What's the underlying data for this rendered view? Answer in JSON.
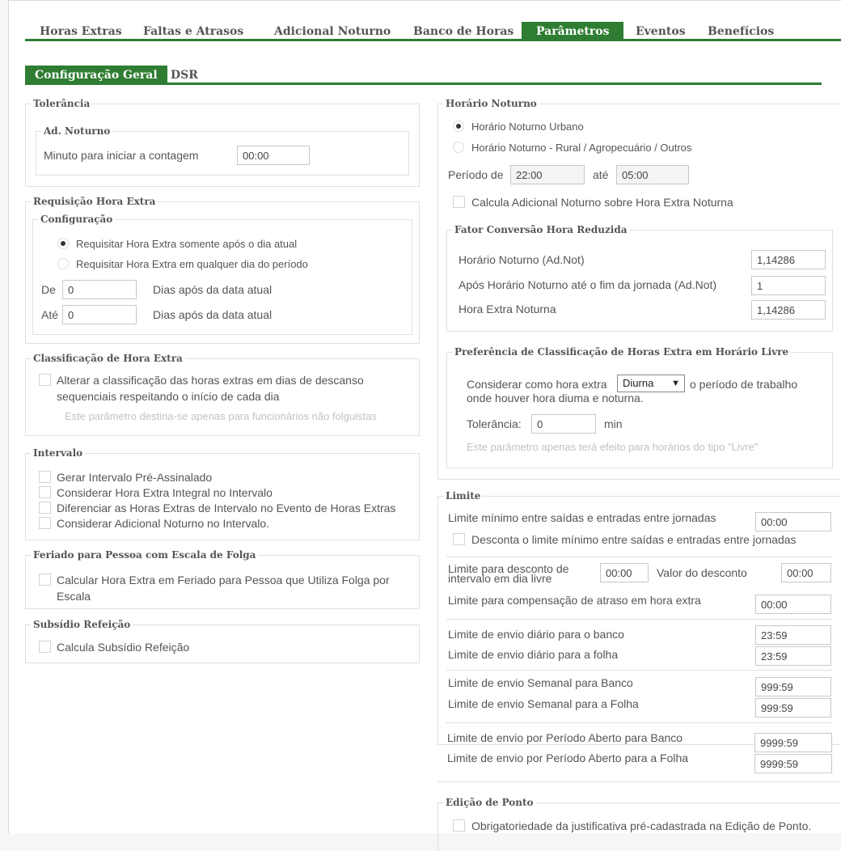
{
  "tabs": [
    "Horas Extras",
    "Faltas e Atrasos",
    "Adicional Noturno",
    "Banco de Horas",
    "Parâmetros",
    "Eventos",
    "Benefícios"
  ],
  "subtabs": [
    "Configuração Geral",
    "DSR"
  ],
  "tolerancia": {
    "title": "Tolerância",
    "ad_noturno": "Ad. Noturno",
    "minuto_label": "Minuto para iniciar a contagem",
    "minuto_value": "00:00"
  },
  "requisicao": {
    "title": "Requisição Hora Extra",
    "config": "Configuração",
    "opt1": "Requisitar Hora Extra somente após o dia atual",
    "opt2": "Requisitar Hora Extra em qualquer dia do período",
    "de_label": "De",
    "de_value": "0",
    "ate_label": "Até",
    "ate_value": "0",
    "dias_apos": "Dias após da data atual"
  },
  "classificacao": {
    "title": "Classificação de Hora Extra",
    "line1": "Alterar a classificação das horas extras em dias de descanso",
    "line2": "sequenciais respeitando o início de cada dia",
    "hint": "Este parâmetro destina-se apenas para funcionários não folguistas"
  },
  "intervalo": {
    "title": "Intervalo",
    "items": [
      "Gerar Intervalo Pré-Assinalado",
      "Considerar Hora Extra Integral no Intervalo",
      "Diferenciar as Horas Extras de Intervalo no Evento de Horas Extras",
      "Considerar Adicional Noturno no Intervalo."
    ]
  },
  "feriado": {
    "title": "Feriado para Pessoa com Escala de Folga",
    "line1": "Calcular Hora Extra em Feriado para Pessoa que Utiliza Folga por",
    "line2": "Escala"
  },
  "subsidio": {
    "title": "Subsídio Refeição",
    "item": "Calcula Subsídio Refeição"
  },
  "horario_noturno": {
    "title": "Horário Noturno",
    "opt1": "Horário Noturno Urbano",
    "opt2": "Horário Noturno - Rural / Agropecuário / Outros",
    "periodo_de": "Período de",
    "de_value": "22:00",
    "ate": "até",
    "ate_value": "05:00",
    "calcula": "Calcula Adicional Noturno sobre Hora Extra Noturna",
    "fator_title": "Fator Conversão Hora Reduzida",
    "fator_rows": [
      {
        "label": "Horário Noturno (Ad.Not)",
        "value": "1,14286"
      },
      {
        "label": "Após Horário Noturno até o fim da jornada (Ad.Not)",
        "value": "1"
      },
      {
        "label": "Hora Extra Noturna",
        "value": "1,14286"
      }
    ],
    "pref_title": "Preferência de Classificação de Horas Extra em Horário Livre",
    "pref_line1_a": "Considerar como hora extra",
    "pref_select": "Diurna",
    "pref_line1_b": "o período de trabalho",
    "pref_line2": "onde houver hora diuma e noturna.",
    "tolerancia_label": "Tolerância:",
    "tolerancia_value": "0",
    "min": "min",
    "hint": "Este parâmetro apenas terá efeito para horários do tipo \"Livre\""
  },
  "limite": {
    "title": "Limite",
    "min_label": "Limite mínimo entre saídas e entradas entre jornadas",
    "min_value": "00:00",
    "desconta": "Desconta o limite mínimo entre saídas e entradas entre jornadas",
    "desc_label_1": "Limite para desconto de",
    "desc_label_2": "intervalo em dia livre",
    "desc_value": "00:00",
    "valor_label": "Valor do desconto",
    "valor_value": "00:00",
    "comp_label": "Limite para compensação de atraso em hora extra",
    "comp_value": "00:00",
    "diario_banco_label": "Limite de envio diário para o banco",
    "diario_banco_value": "23:59",
    "diario_folha_label": "Limite de envio diário para a folha",
    "diario_folha_value": "23:59",
    "sem_banco_label": "Limite de envio Semanal para Banco",
    "sem_banco_value": "999:59",
    "sem_folha_label": "Limite de envio Semanal para a Folha",
    "sem_folha_value": "999:59",
    "per_banco_label": "Limite de envio por Período Aberto para Banco",
    "per_banco_value": "9999:59",
    "per_folha_label": "Limite de envio por Período Aberto para a Folha",
    "per_folha_value": "9999:59"
  },
  "edicao": {
    "title": "Edição de Ponto",
    "item": "Obrigatoriedade da justificativa pré-cadastrada na Edição de Ponto."
  }
}
